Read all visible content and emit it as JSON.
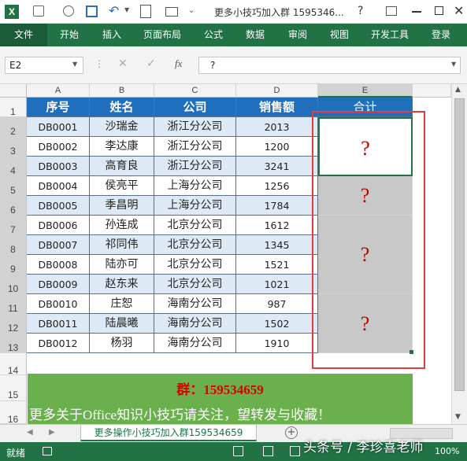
{
  "title_bar": {
    "doc_title": "更多小技巧加入群 1595346...",
    "help_glyph": "?",
    "icons": [
      "excel-logo-icon",
      "save-icon",
      "undo-icon",
      "redo-icon",
      "print-preview-icon",
      "toolbox-icon"
    ]
  },
  "ribbon": {
    "tabs": [
      "文件",
      "开始",
      "插入",
      "页面布局",
      "公式",
      "数据",
      "审阅",
      "视图",
      "开发工具",
      "登录"
    ]
  },
  "formula_bar": {
    "name_box": "E2",
    "fx_label": "fx",
    "formula_value": "?"
  },
  "columns": [
    "A",
    "B",
    "C",
    "D",
    "E"
  ],
  "rows": [
    "1",
    "2",
    "3",
    "4",
    "5",
    "6",
    "7",
    "8",
    "9",
    "10",
    "11",
    "12",
    "13",
    "14",
    "15",
    "16"
  ],
  "table": {
    "headers": [
      "序号",
      "姓名",
      "公司",
      "销售额",
      "合计"
    ],
    "records": [
      [
        "DB0001",
        "沙瑞金",
        "浙江分公司",
        "2013"
      ],
      [
        "DB0002",
        "李达康",
        "浙江分公司",
        "1200"
      ],
      [
        "DB0003",
        "高育良",
        "浙江分公司",
        "3241"
      ],
      [
        "DB0004",
        "侯亮平",
        "上海分公司",
        "1256"
      ],
      [
        "DB0005",
        "季昌明",
        "上海分公司",
        "1784"
      ],
      [
        "DB0006",
        "孙连成",
        "北京分公司",
        "1612"
      ],
      [
        "DB0007",
        "祁同伟",
        "北京分公司",
        "1345"
      ],
      [
        "DB0008",
        "陆亦可",
        "北京分公司",
        "1521"
      ],
      [
        "DB0009",
        "赵东来",
        "北京分公司",
        "1021"
      ],
      [
        "DB0010",
        "庄恕",
        "海南分公司",
        "987"
      ],
      [
        "DB0011",
        "陆晨曦",
        "海南分公司",
        "1502"
      ],
      [
        "DB0012",
        "杨羽",
        "海南分公司",
        "1910"
      ]
    ],
    "merged_totals": [
      "?",
      "?",
      "?",
      "?"
    ]
  },
  "banner": {
    "line1": "群：159534659",
    "line2": "更多关于Office知识小技巧请关注，望转发与收藏！"
  },
  "sheet_tab": "更多操作小技巧加入群159534659",
  "status": {
    "ready": "就绪",
    "zoom": "100%"
  },
  "watermark": "头条号 / 李珍喜老师",
  "colors": {
    "excel_green": "#217346",
    "header_blue": "#1f6fbd",
    "row_blue": "#dde9f5",
    "merged_gray": "#c8c8c8",
    "highlight_red": "#e03c3c",
    "question_red": "#c00000",
    "banner_green": "#6ab04c"
  }
}
